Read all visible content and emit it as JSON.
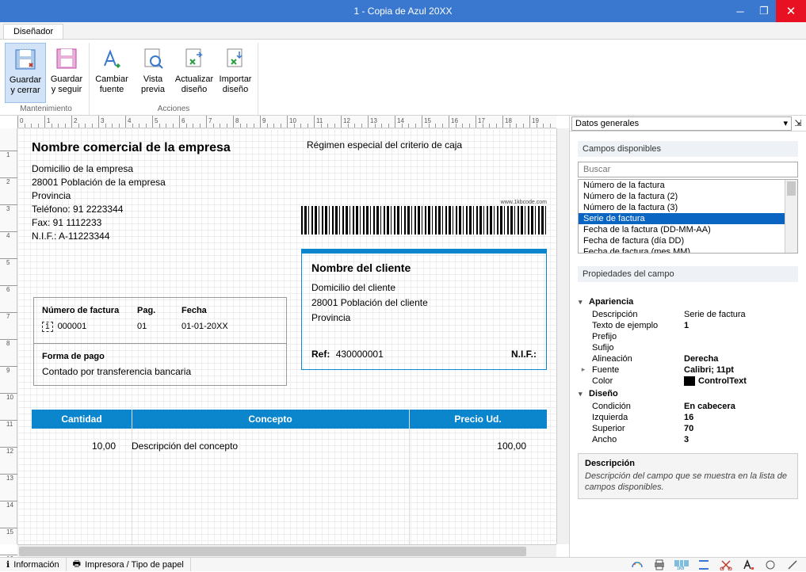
{
  "titlebar": {
    "title": "1 - Copia de Azul 20XX"
  },
  "tabs": {
    "designer": "Diseñador"
  },
  "ribbon": {
    "save_close": "Guardar\ny cerrar",
    "save_continue": "Guardar\ny seguir",
    "change_font": "Cambiar\nfuente",
    "preview": "Vista\nprevia",
    "refresh_design": "Actualizar\ndiseño",
    "import_design": "Importar\ndiseño",
    "group_maintenance": "Mantenimiento",
    "group_actions": "Acciones"
  },
  "invoice": {
    "company_name": "Nombre comercial de la empresa",
    "company_address": "Domicilio de la empresa",
    "company_zip_city": "28001     Población de la empresa",
    "company_province": "Provincia",
    "company_phone": "Teléfono:   91 2223344",
    "company_fax": "Fax:   91 1112233",
    "company_nif": "N.I.F.:  A-11223344",
    "regimen": "Régimen especial del criterio de caja",
    "barcode_url": "www.1kbcode.com",
    "client_title": "Nombre del cliente",
    "client_address": "Domicilio del cliente",
    "client_zip_city": "28001  Población del cliente",
    "client_province": "Provincia",
    "ref_label": "Ref:",
    "ref_value": "430000001",
    "nif_label": "N.I.F.:",
    "meta": {
      "num_label": "Número de factura",
      "page_label": "Pag.",
      "date_label": "Fecha",
      "serie": "1",
      "num": "000001",
      "page": "01",
      "date": "01-01-20XX"
    },
    "payment_label": "Forma de pago",
    "payment_value": "Contado por transferencia bancaria",
    "cols": {
      "qty": "Cantidad",
      "desc": "Concepto",
      "price": "Precio Ud."
    },
    "line": {
      "qty": "10,00",
      "desc": "Descripción del concepto",
      "price": "100,00"
    }
  },
  "panel": {
    "tab_label": "Datos generales",
    "section_fields": "Campos disponibles",
    "search_placeholder": "Buscar",
    "fields": [
      "Número de la factura",
      "Número de la factura (2)",
      "Número de la factura (3)",
      "Serie de factura",
      "Fecha de la factura (DD-MM-AA)",
      "Fecha de factura (día DD)",
      "Fecha de factura (mes MM)"
    ],
    "selected_field_index": 3,
    "section_props": "Propiedades del campo",
    "groups": {
      "appearance": "Apariencia",
      "design": "Diseño"
    },
    "props": {
      "descripcion_k": "Descripción",
      "descripcion_v": "Serie de factura",
      "texto_k": "Texto de ejemplo",
      "texto_v": "1",
      "prefijo_k": "Prefijo",
      "prefijo_v": "",
      "sufijo_k": "Sufijo",
      "sufijo_v": "",
      "alineacion_k": "Alineación",
      "alineacion_v": "Derecha",
      "fuente_k": "Fuente",
      "fuente_v": "Calibri; 11pt",
      "color_k": "Color",
      "color_v": "ControlText",
      "condicion_k": "Condición",
      "condicion_v": "En cabecera",
      "izquierda_k": "Izquierda",
      "izquierda_v": "16",
      "superior_k": "Superior",
      "superior_v": "70",
      "ancho_k": "Ancho",
      "ancho_v": "3"
    },
    "help_title": "Descripción",
    "help_text": "Descripción del campo que se muestra en la lista de campos disponibles."
  },
  "statusbar": {
    "info": "Información",
    "printer": "Impresora / Tipo de papel"
  }
}
